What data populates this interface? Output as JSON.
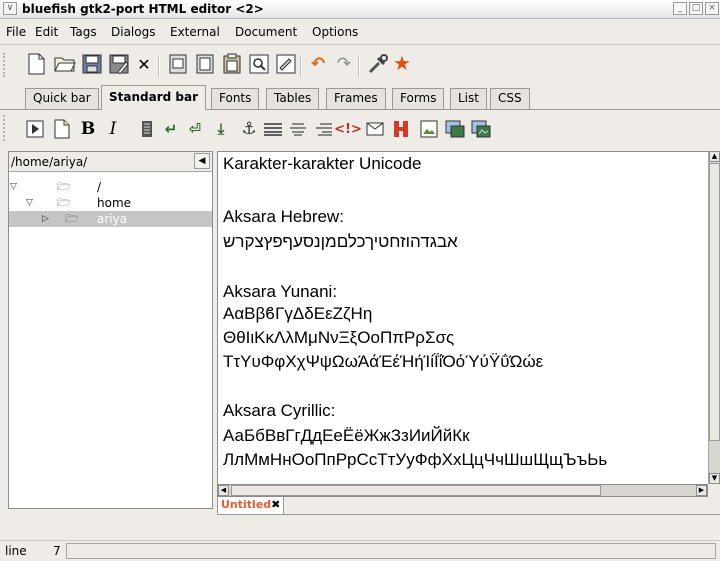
{
  "window": {
    "title": "bluefish gtk2-port HTML editor <2>"
  },
  "menu": {
    "items": [
      {
        "label": "File"
      },
      {
        "label": "Edit"
      },
      {
        "label": "Tags"
      },
      {
        "label": "Dialogs"
      },
      {
        "label": "External"
      },
      {
        "label": "Document"
      },
      {
        "label": "Options"
      }
    ]
  },
  "tabs": [
    {
      "label": "Quick bar"
    },
    {
      "label": "Standard bar",
      "active": true
    },
    {
      "label": "Fonts"
    },
    {
      "label": "Tables"
    },
    {
      "label": "Frames"
    },
    {
      "label": "Forms"
    },
    {
      "label": "List"
    },
    {
      "label": "CSS"
    }
  ],
  "toolbar2": {
    "bold": "B",
    "italic": "I"
  },
  "filetree": {
    "path": "/home/ariya/",
    "nodes": [
      {
        "name": "/"
      },
      {
        "name": "home"
      },
      {
        "name": "ariya",
        "selected": true
      }
    ]
  },
  "editor": {
    "lines": [
      "Karakter-karakter Unicode",
      "",
      "Aksara Hebrew:",
      "אבגדהוזחטיךכלםמןנסעףפץצקרש",
      "",
      "Aksara Yunani:",
      "ΑαΒβϐΓγΔδΕεΖζΗη",
      "ΘθΙιΚκΛλΜμΝνΞξΟοΠπΡρΣσς",
      "ΤτΥυΦφΧχΨψΩωΆάΈέΉήΊίΪΐΌόΎύΫΰΏώε",
      "",
      "Aksara Cyrillic:",
      "АаБбВвГгДдЕеЁёЖжЗзИиЙйКк",
      "ЛлМмНнОоПпРрСсТтУуФфХхЦцЧчШшЩщЪъЬь"
    ]
  },
  "document_tab": {
    "label": "Untitled"
  },
  "status": {
    "label": "line",
    "value": "7"
  }
}
